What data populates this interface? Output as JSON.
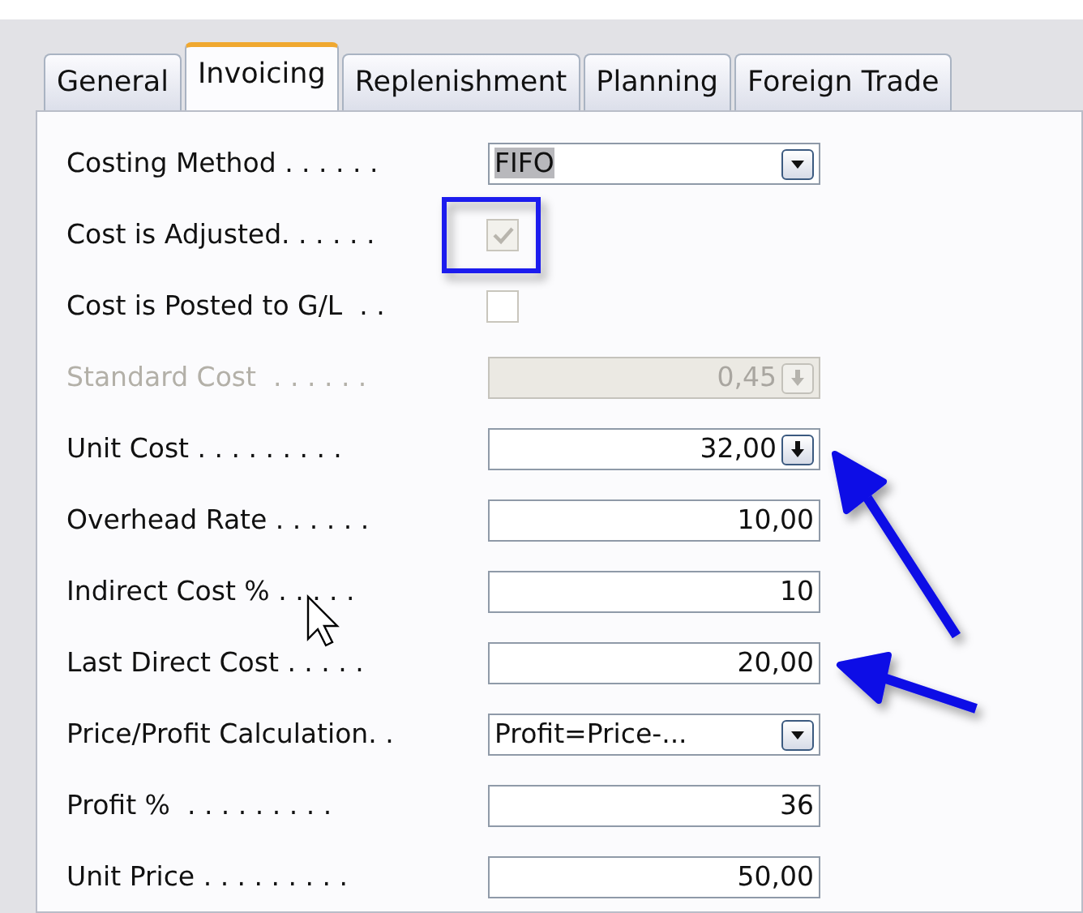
{
  "tabs": [
    {
      "label": "General",
      "selected": false
    },
    {
      "label": "Invoicing",
      "selected": true
    },
    {
      "label": "Replenishment",
      "selected": false
    },
    {
      "label": "Planning",
      "selected": false
    },
    {
      "label": "Foreign Trade",
      "selected": false
    }
  ],
  "fields": [
    {
      "kind": "dropdown",
      "label": "Costing Method . . . . . .",
      "value": "FIFO",
      "value_selected": true,
      "disabled": false
    },
    {
      "kind": "checkbox",
      "label": "Cost is Adjusted. . . . . .",
      "checked": true,
      "disabled": true,
      "highlighted": true
    },
    {
      "kind": "checkbox",
      "label": "Cost is Posted to G/L  . .",
      "checked": false,
      "disabled": false,
      "highlighted": false
    },
    {
      "kind": "number",
      "label": "Standard Cost  . . . . . .",
      "value": "0,45",
      "lookup": true,
      "disabled": true
    },
    {
      "kind": "number",
      "label": "Unit Cost . . . . . . . . .",
      "value": "32,00",
      "lookup": true,
      "disabled": false
    },
    {
      "kind": "number",
      "label": "Overhead Rate . . . . . .",
      "value": "10,00",
      "lookup": false,
      "disabled": false
    },
    {
      "kind": "number",
      "label": "Indirect Cost % . . . . .",
      "value": "10",
      "lookup": false,
      "disabled": false
    },
    {
      "kind": "number",
      "label": "Last Direct Cost . . . . .",
      "value": "20,00",
      "lookup": false,
      "disabled": false
    },
    {
      "kind": "dropdown",
      "label": "Price/Profit Calculation. .",
      "value": "Profit=Price-...",
      "value_selected": false,
      "disabled": false
    },
    {
      "kind": "number",
      "label": "Profit %  . . . . . . . . .",
      "value": "36",
      "lookup": false,
      "disabled": false
    },
    {
      "kind": "number",
      "label": "Unit Price . . . . . . . . .",
      "value": "50,00",
      "lookup": false,
      "disabled": false
    }
  ]
}
